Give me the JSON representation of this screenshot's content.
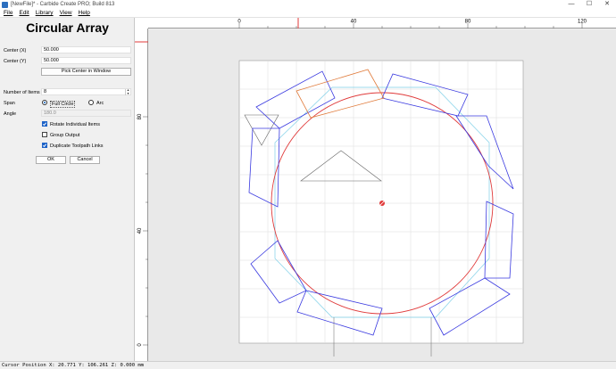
{
  "window": {
    "title": "[NewFile]* - Carbide Create PRO; Build 813",
    "minimize": "—",
    "maximize": "☐",
    "close": "✕"
  },
  "menu": [
    "File",
    "Edit",
    "Library",
    "View",
    "Help"
  ],
  "panel": {
    "title": "Circular Array",
    "center_x_label": "Center (X)",
    "center_x_value": "50.000",
    "center_y_label": "Center (Y)",
    "center_y_value": "50.000",
    "pick_center_button": "Pick Center in Window",
    "num_items_label": "Number of Items",
    "num_items_value": "8",
    "span_label": "Span",
    "span_full": "Full Circle",
    "span_arc": "Arc",
    "span_selected": "full",
    "angle_label": "Angle",
    "angle_value": "180.0",
    "rotate_label": "Rotate Individual Items",
    "rotate_checked": true,
    "group_label": "Group Output",
    "group_checked": false,
    "duplicate_label": "Duplicate Toolpath Links",
    "duplicate_checked": true,
    "ok_button": "OK",
    "cancel_button": "Cancel"
  },
  "rulers": {
    "top_ticks": [
      "0",
      "40",
      "80",
      "120"
    ],
    "left_ticks": [
      "80",
      "40",
      "0"
    ]
  },
  "status": {
    "text": "Cursor Position X: 20.771 Y: 106.261 Z: 0.000 mm"
  },
  "colors": {
    "array_rect": "#3a3ae0",
    "circle": "#e03a3a",
    "selected": "#e07a3a",
    "toolpath": "#7fd0e8",
    "grid": "#d4d4d4",
    "stock": "#ffffff"
  }
}
